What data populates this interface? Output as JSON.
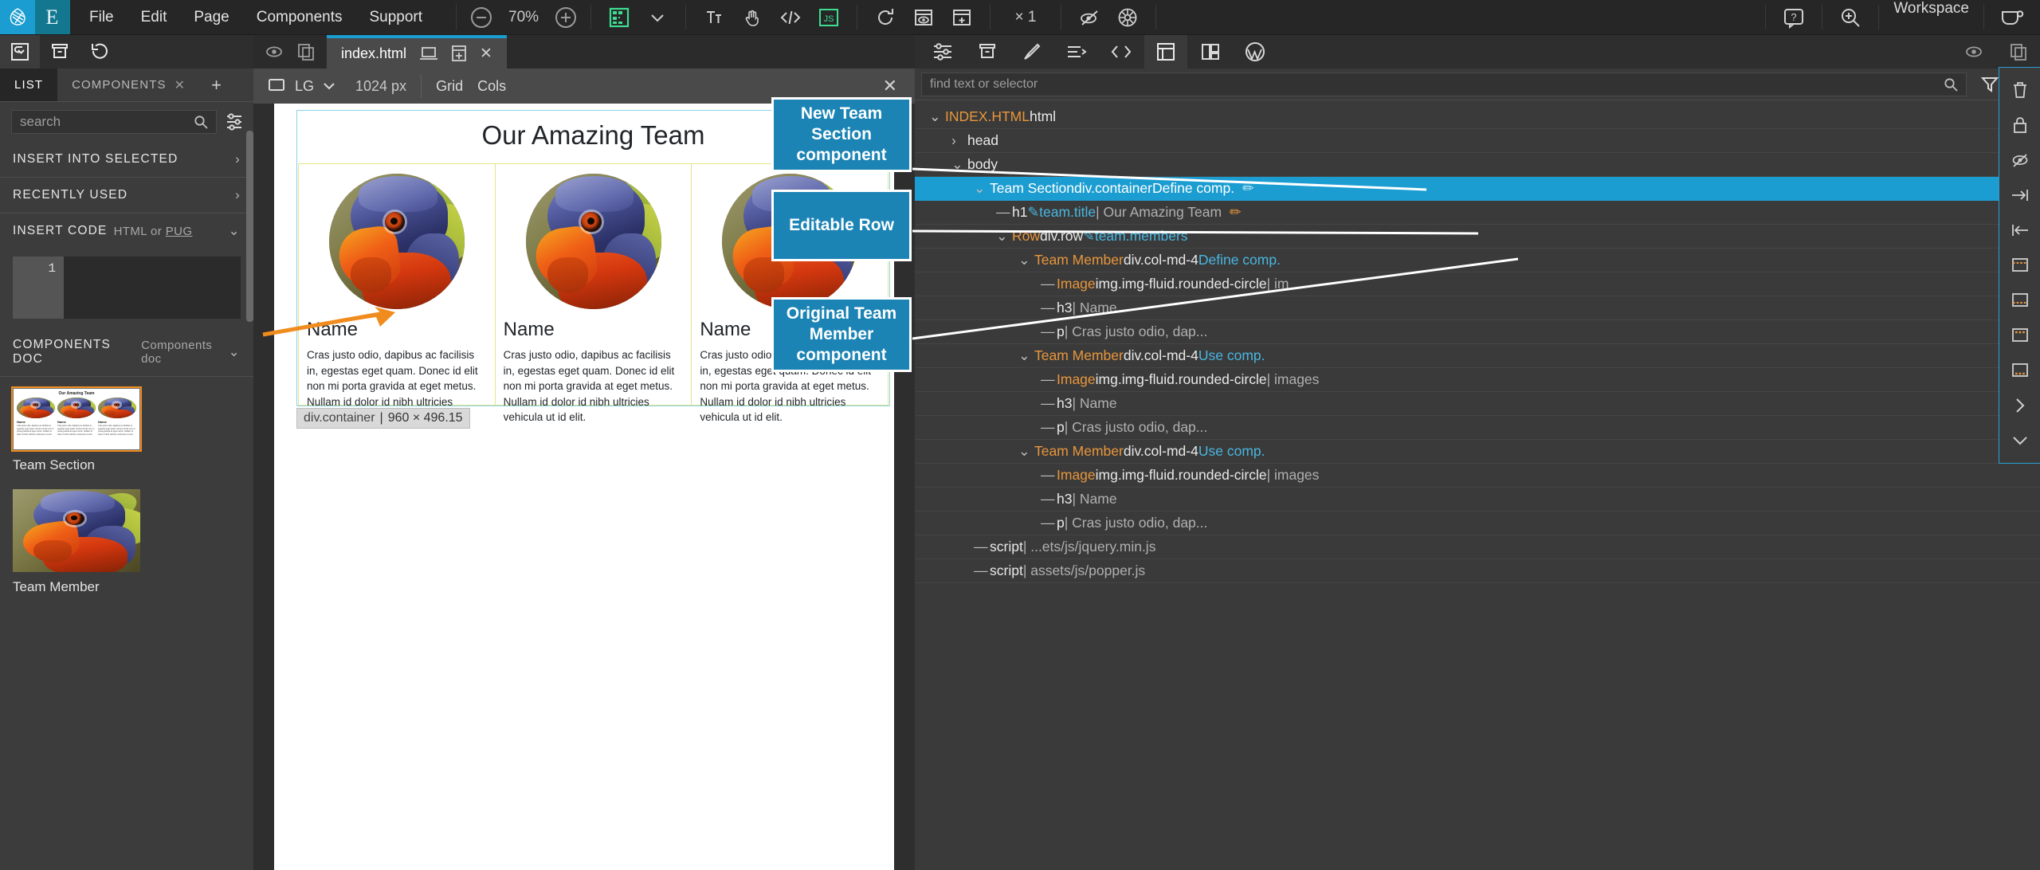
{
  "app": {
    "menu": [
      "File",
      "Edit",
      "Page",
      "Components",
      "Support"
    ],
    "zoom_level": "70%",
    "multiplier": "× 1",
    "workspace_label": "Workspace"
  },
  "left_panel": {
    "tabs": [
      {
        "label": "LIST",
        "active": true,
        "closable": false
      },
      {
        "label": "COMPONENTS",
        "active": false,
        "closable": true
      }
    ],
    "add_tab": "+",
    "search_placeholder": "search",
    "sections": [
      {
        "title": "INSERT INTO SELECTED",
        "sub": "",
        "arrow": "›"
      },
      {
        "title": "RECENTLY USED",
        "sub": "",
        "arrow": "›"
      }
    ],
    "insert_code": {
      "title": "INSERT CODE",
      "sub_pre": "HTML or ",
      "sub_link": "PUG",
      "arrow": "⌄",
      "line_number": "1"
    },
    "components_doc": {
      "title": "COMPONENTS DOC",
      "sub": "Components doc",
      "arrow": "⌄"
    },
    "components": [
      {
        "name": "Team Section",
        "thumb": "team-section-thumb",
        "selected": true
      },
      {
        "name": "Team Member",
        "thumb": "team-member-thumb",
        "selected": false
      }
    ]
  },
  "center": {
    "tab": {
      "filename": "index.html",
      "close": "✕"
    },
    "viewport": {
      "breakpoint": "LG",
      "width": "1024 px",
      "grid_label": "Grid",
      "cols_label": "Cols",
      "close": "✕"
    },
    "page": {
      "title": "Our Amazing Team",
      "members": [
        {
          "name": "Name",
          "text": "Cras justo odio, dapibus ac facilisis in, egestas eget quam. Donec id elit non mi porta gravida at eget metus. Nullam id dolor id nibh ultricies vehicula ut id elit."
        },
        {
          "name": "Name",
          "text": "Cras justo odio, dapibus ac facilisis in, egestas eget quam. Donec id elit non mi porta gravida at eget metus. Nullam id dolor id nibh ultricies vehicula ut id elit."
        },
        {
          "name": "Name",
          "text": "Cras justo odio, dapibus ac facilisis in, egestas eget quam. Donec id elit non mi porta gravida at eget metus. Nullam id dolor id nibh ultricies vehicula ut id elit."
        }
      ],
      "size_badge": {
        "selector": "div.container",
        "separator": "|",
        "dims": "960 × 496.15"
      }
    },
    "callouts": [
      {
        "text": "New Team Section component"
      },
      {
        "text": "Editable Row"
      },
      {
        "text": "Original Team Member component"
      }
    ]
  },
  "right_panel": {
    "find_placeholder": "find text or selector",
    "tree": [
      {
        "indent": 0,
        "twisty": "⌄",
        "parts": [
          {
            "t": "INDEX.HTML",
            "c": "orange"
          },
          {
            "t": " html",
            "c": "white"
          }
        ],
        "selected": false
      },
      {
        "indent": 1,
        "twisty": "›",
        "parts": [
          {
            "t": "head",
            "c": "white"
          }
        ],
        "selected": false
      },
      {
        "indent": 1,
        "twisty": "⌄",
        "parts": [
          {
            "t": "body",
            "c": "white"
          }
        ],
        "selected": false
      },
      {
        "indent": 2,
        "twisty": "⌄",
        "parts": [
          {
            "t": "Team Section",
            "c": "white"
          },
          {
            "t": " div.container",
            "c": "white"
          },
          {
            "t": "  Define comp.",
            "c": "cyan"
          },
          {
            "t": " ✏",
            "c": "brush"
          }
        ],
        "selected": true
      },
      {
        "indent": 3,
        "twisty": "—",
        "parts": [
          {
            "t": "h1",
            "c": "white"
          },
          {
            "t": "  ✎ ",
            "c": "cyan"
          },
          {
            "t": "team.title",
            "c": "cyan"
          },
          {
            "t": " | Our Amazing Team",
            "c": "grey"
          },
          {
            "t": " ✏",
            "c": "brush"
          }
        ],
        "selected": false
      },
      {
        "indent": 3,
        "twisty": "⌄",
        "parts": [
          {
            "t": "Row",
            "c": "orange"
          },
          {
            "t": " div.row",
            "c": "white"
          },
          {
            "t": "  ✎ ",
            "c": "cyan"
          },
          {
            "t": "team.members",
            "c": "cyan"
          }
        ],
        "selected": false
      },
      {
        "indent": 4,
        "twisty": "⌄",
        "parts": [
          {
            "t": "Team Member",
            "c": "orange"
          },
          {
            "t": " div.col-md-4",
            "c": "white"
          },
          {
            "t": "  Define comp.",
            "c": "cyan"
          }
        ],
        "selected": false
      },
      {
        "indent": 5,
        "twisty": "—",
        "parts": [
          {
            "t": "Image",
            "c": "orange"
          },
          {
            "t": " img.img-fluid.rounded-circle",
            "c": "white"
          },
          {
            "t": " | im",
            "c": "grey"
          }
        ],
        "selected": false
      },
      {
        "indent": 5,
        "twisty": "—",
        "parts": [
          {
            "t": "h3",
            "c": "white"
          },
          {
            "t": " | Name",
            "c": "grey"
          }
        ],
        "selected": false
      },
      {
        "indent": 5,
        "twisty": "—",
        "parts": [
          {
            "t": "p",
            "c": "white"
          },
          {
            "t": " | Cras justo odio, dap...",
            "c": "grey"
          }
        ],
        "selected": false
      },
      {
        "indent": 4,
        "twisty": "⌄",
        "parts": [
          {
            "t": "Team Member",
            "c": "orange"
          },
          {
            "t": " div.col-md-4",
            "c": "white"
          },
          {
            "t": "  Use comp.",
            "c": "cyan"
          }
        ],
        "selected": false
      },
      {
        "indent": 5,
        "twisty": "—",
        "parts": [
          {
            "t": "Image",
            "c": "orange"
          },
          {
            "t": " img.img-fluid.rounded-circle",
            "c": "white"
          },
          {
            "t": " | images",
            "c": "grey"
          }
        ],
        "selected": false
      },
      {
        "indent": 5,
        "twisty": "—",
        "parts": [
          {
            "t": "h3",
            "c": "white"
          },
          {
            "t": " | Name",
            "c": "grey"
          }
        ],
        "selected": false
      },
      {
        "indent": 5,
        "twisty": "—",
        "parts": [
          {
            "t": "p",
            "c": "white"
          },
          {
            "t": " | Cras justo odio, dap...",
            "c": "grey"
          }
        ],
        "selected": false
      },
      {
        "indent": 4,
        "twisty": "⌄",
        "parts": [
          {
            "t": "Team Member",
            "c": "orange"
          },
          {
            "t": " div.col-md-4",
            "c": "white"
          },
          {
            "t": "  Use comp.",
            "c": "cyan"
          }
        ],
        "selected": false
      },
      {
        "indent": 5,
        "twisty": "—",
        "parts": [
          {
            "t": "Image",
            "c": "orange"
          },
          {
            "t": " img.img-fluid.rounded-circle",
            "c": "white"
          },
          {
            "t": " | images",
            "c": "grey"
          }
        ],
        "selected": false
      },
      {
        "indent": 5,
        "twisty": "—",
        "parts": [
          {
            "t": "h3",
            "c": "white"
          },
          {
            "t": " | Name",
            "c": "grey"
          }
        ],
        "selected": false
      },
      {
        "indent": 5,
        "twisty": "—",
        "parts": [
          {
            "t": "p",
            "c": "white"
          },
          {
            "t": " | Cras justo odio, dap...",
            "c": "grey"
          }
        ],
        "selected": false
      },
      {
        "indent": 2,
        "twisty": "—",
        "parts": [
          {
            "t": "script",
            "c": "white"
          },
          {
            "t": " | ...ets/js/jquery.min.js",
            "c": "grey"
          }
        ],
        "selected": false
      },
      {
        "indent": 2,
        "twisty": "—",
        "parts": [
          {
            "t": "script",
            "c": "white"
          },
          {
            "t": " | assets/js/popper.js",
            "c": "grey"
          }
        ],
        "selected": false
      }
    ]
  },
  "colors": {
    "accent": "#1b9dd1",
    "callout": "#1b84b5",
    "orange": "#e8963c",
    "green": "#3ddc91",
    "arrow_orange": "#f08c1e"
  }
}
